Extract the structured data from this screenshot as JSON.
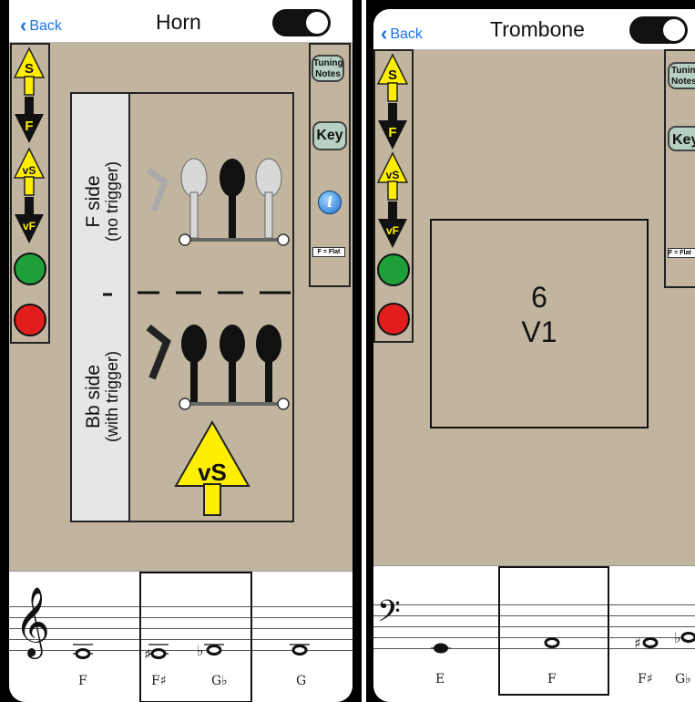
{
  "horn": {
    "nav": {
      "back": "Back",
      "title": "Horn"
    },
    "legend": {
      "s": "S",
      "f": "F",
      "vs": "vS",
      "vf": "vF"
    },
    "side_panel": {
      "tuning_line1": "Tuning",
      "tuning_line2": "Notes",
      "key": "Key",
      "info": "i",
      "flat": "F = Flat"
    },
    "chart": {
      "f_side_line1": "F side",
      "f_side_line2": "(no trigger)",
      "bb_side_line1": "Bb side",
      "bb_side_line2": "(with trigger)",
      "arrow_label": "vS"
    },
    "staff": {
      "clef": "𝄞",
      "notes": [
        "F",
        "F♯",
        "G♭",
        "G"
      ]
    }
  },
  "trombone": {
    "nav": {
      "back": "Back",
      "title": "Trombone"
    },
    "legend": {
      "s": "S",
      "f": "F",
      "vs": "vS",
      "vf": "vF"
    },
    "side_panel": {
      "tuning_line1": "Tuning",
      "tuning_line2": "Notes",
      "key": "Key",
      "flat": "F = Flat"
    },
    "position": {
      "number": "6",
      "label": "V1"
    },
    "staff": {
      "clef": "𝄢",
      "notes": [
        "E",
        "F",
        "F♯",
        "G♭"
      ]
    }
  },
  "colors": {
    "background": "#c1b59f",
    "yellow": "#ffee00",
    "green": "#1e9f3a",
    "red": "#e21d1d",
    "link": "#1a73e8"
  }
}
